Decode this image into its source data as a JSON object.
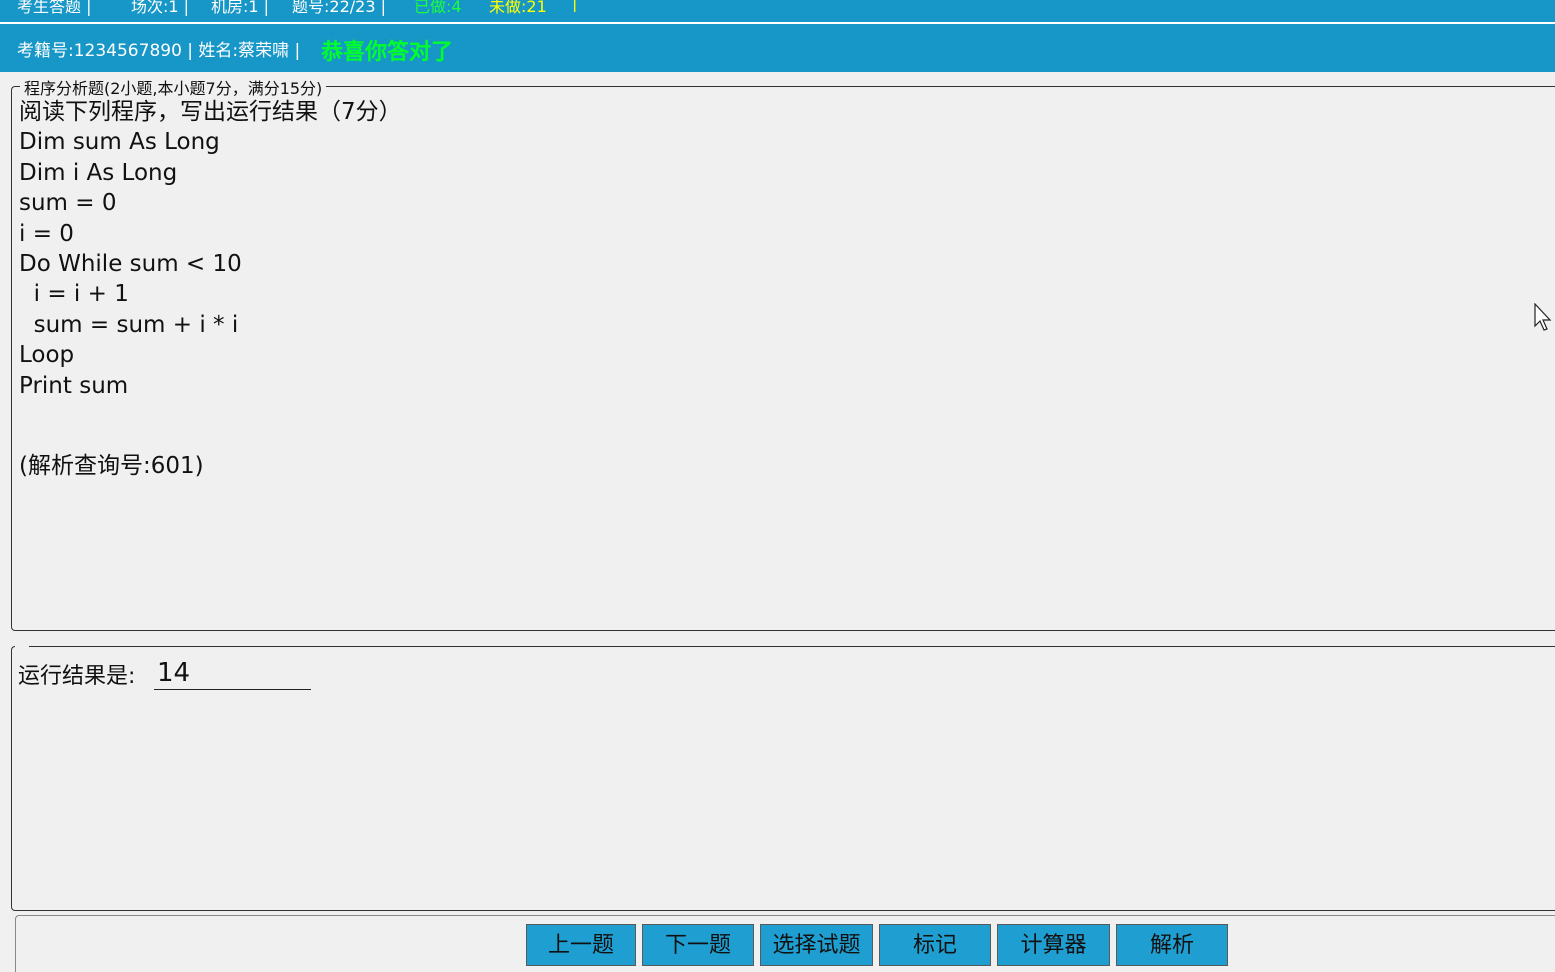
{
  "topbar": {
    "items": [
      {
        "text": "考生答题   |",
        "color": "#ffffff"
      },
      {
        "text": "场次:1 |",
        "color": "#ffffff"
      },
      {
        "text": "机房:1 |",
        "color": "#ffffff"
      },
      {
        "text": "题号:22/23 |",
        "color": "#ffffff"
      },
      {
        "text": "已做:4",
        "color": "#19ff3c"
      },
      {
        "text": "未做:21",
        "color": "#ffff00"
      },
      {
        "text": "|",
        "color": "#ffffff"
      }
    ]
  },
  "infobar": {
    "candidate": "考籍号:1234567890 | 姓名:蔡荣啸 |",
    "congrats": "恭喜你答对了"
  },
  "question": {
    "legend": "程序分析题(2小题,本小题7分，满分15分)",
    "lines": [
      "阅读下列程序，写出运行结果（7分）",
      "Dim sum As Long",
      "Dim i As Long",
      "sum = 0",
      "i = 0",
      "Do While sum < 10",
      "  i = i + 1",
      "  sum = sum + i * i",
      "Loop",
      "Print sum"
    ],
    "reference": "(解析查询号:601)"
  },
  "answer": {
    "label": "运行结果是:",
    "value": "14"
  },
  "nav": {
    "buttons": [
      "上一题",
      "下一题",
      "选择试题",
      "标记",
      "计算器",
      "解析"
    ]
  },
  "colors": {
    "header_bg": "#1797c8",
    "button_bg": "#1f9ed1",
    "congrats": "#00ff2a",
    "done": "#19ff3c",
    "todo": "#ffff00"
  }
}
